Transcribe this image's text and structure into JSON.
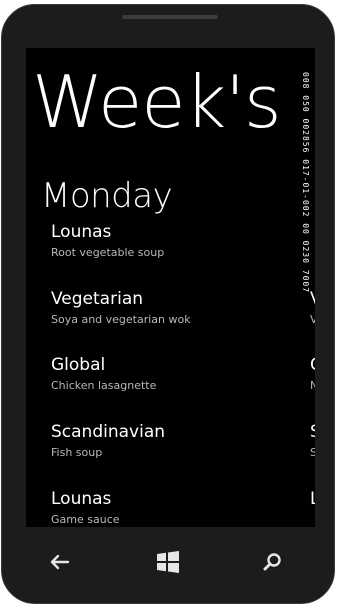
{
  "app": {
    "title": "Week's"
  },
  "status_vertical": "008 050 002856 017-01-002 00 0230 7007",
  "day": "Monday",
  "menu": [
    {
      "name": "Lounas",
      "desc": "Root vegetable soup",
      "peek": "L",
      "peek_desc": ""
    },
    {
      "name": "Vegetarian",
      "desc": "Soya and vegetarian wok",
      "peek": "V",
      "peek_desc": "V"
    },
    {
      "name": "Global",
      "desc": "Chicken lasagnette",
      "peek": "G",
      "peek_desc": "N"
    },
    {
      "name": "Scandinavian",
      "desc": "Fish soup",
      "peek": "S",
      "peek_desc": "S"
    },
    {
      "name": "Lounas",
      "desc": "Game sauce",
      "peek": "L",
      "peek_desc": ""
    }
  ],
  "nav": {
    "back_icon": "back-arrow-icon",
    "start_icon": "windows-start-icon",
    "search_icon": "search-icon"
  }
}
